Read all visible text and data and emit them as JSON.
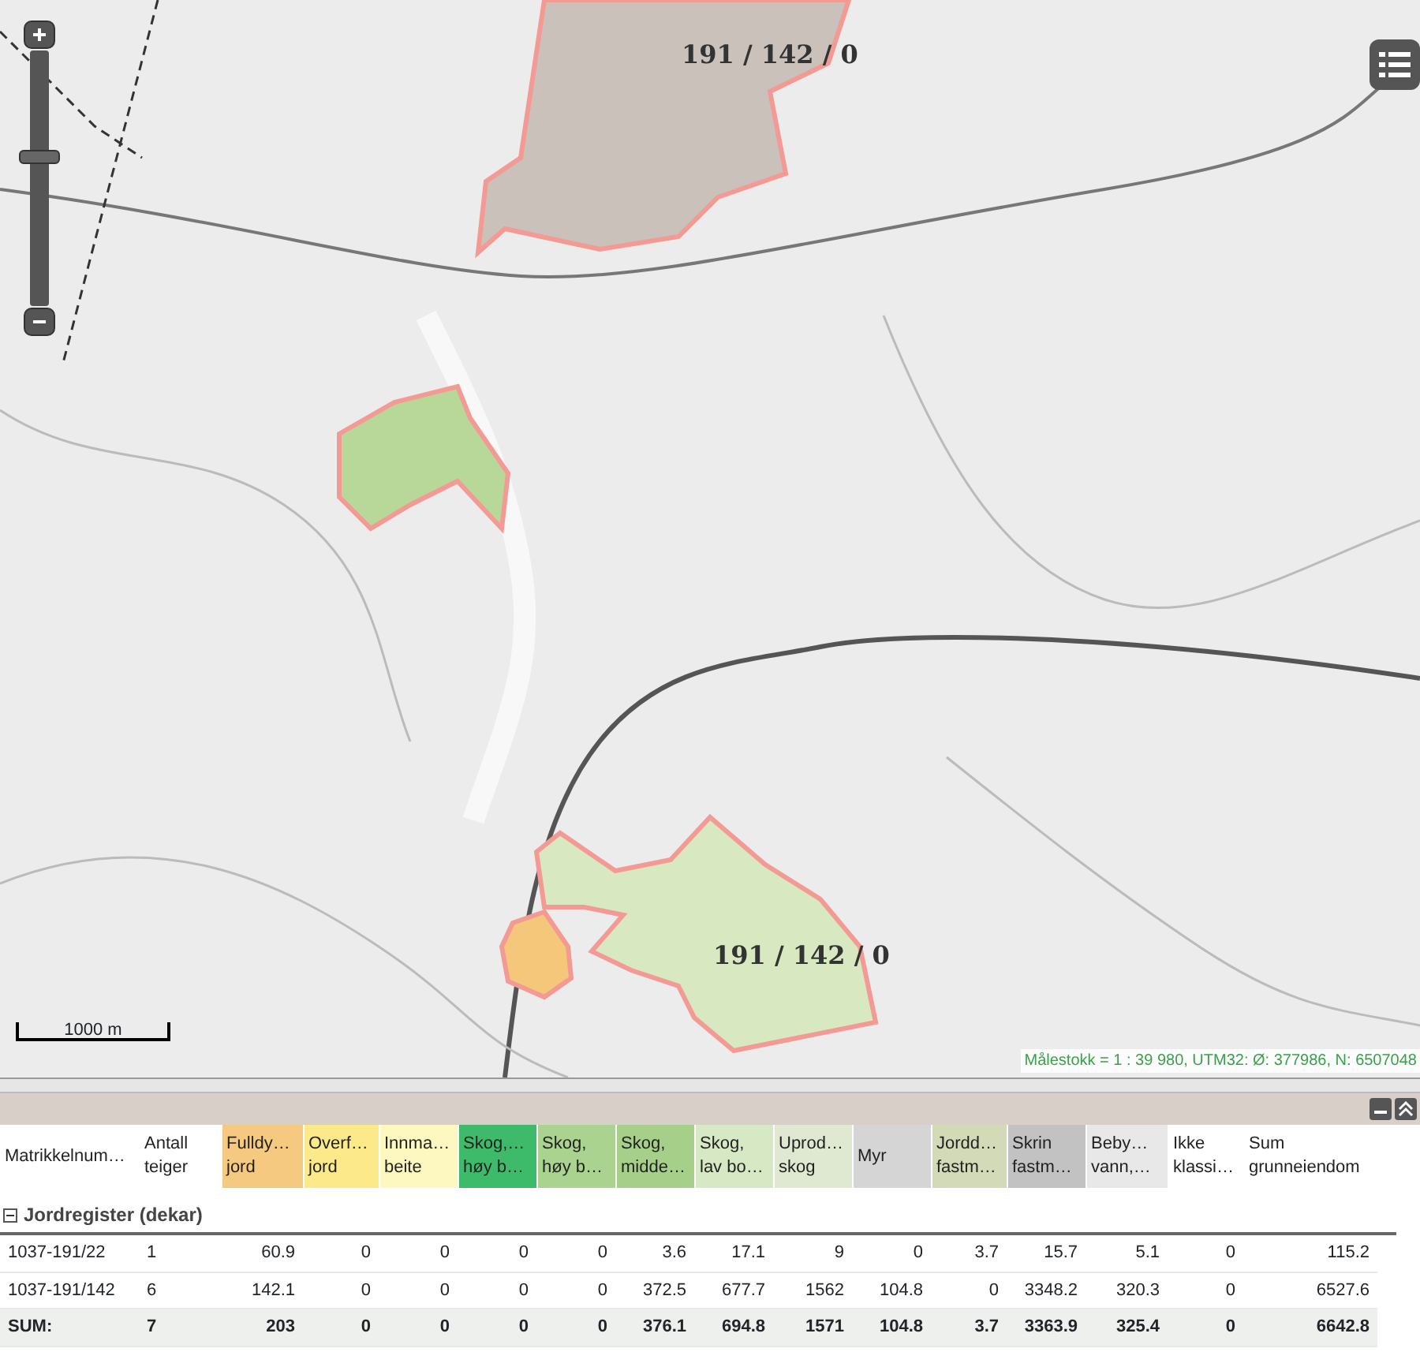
{
  "map": {
    "zoom_slider": {
      "level": 0.6
    },
    "parcels": [
      {
        "label": "191 / 142 / 0"
      },
      {
        "label": "191 / 142 / 0"
      }
    ],
    "scale_bar": "1000 m",
    "scale_text": "Målestokk = 1 : 39 980, UTM32: Ø: 377986, N: 6507048"
  },
  "panel": {
    "columns": [
      {
        "label": "Matrikkelnum…",
        "color": "#ffffff"
      },
      {
        "label": "Antall\nteiger",
        "color": "#ffffff"
      },
      {
        "label": "Fulldy…\njord",
        "color": "#f5c97f"
      },
      {
        "label": "Overf…\njord",
        "color": "#fbe98a"
      },
      {
        "label": "Innma…\nbeite",
        "color": "#fdf7c0"
      },
      {
        "label": "Skog,…\nhøy b…",
        "color": "#3dbb6a"
      },
      {
        "label": "Skog,\nhøy b…",
        "color": "#a9d38e"
      },
      {
        "label": "Skog,\nmidde…",
        "color": "#a6cf8a"
      },
      {
        "label": "Skog,\nlav bo…",
        "color": "#d6e8c4"
      },
      {
        "label": "Uprod…\nskog",
        "color": "#dfe9d1"
      },
      {
        "label": "Myr",
        "color": "#d5d5d5"
      },
      {
        "label": "Jordd…\nfastm…",
        "color": "#d3dab8"
      },
      {
        "label": "Skrin\nfastm…",
        "color": "#c2c2c2"
      },
      {
        "label": "Beby…\nvann,…",
        "color": "#e8e8e8"
      },
      {
        "label": "Ikke\nklassi…",
        "color": "#ffffff"
      },
      {
        "label": "Sum\ngrunneiendom",
        "color": "#ffffff"
      }
    ],
    "group": {
      "label": "Jordregister (dekar)",
      "expanded": true
    },
    "rows": [
      {
        "kind": "data",
        "cells": [
          "1037-191/22",
          "1",
          "60.9",
          "0",
          "0",
          "0",
          "0",
          "3.6",
          "17.1",
          "9",
          "0",
          "3.7",
          "15.7",
          "5.1",
          "0",
          "115.2"
        ]
      },
      {
        "kind": "data",
        "cells": [
          "1037-191/142",
          "6",
          "142.1",
          "0",
          "0",
          "0",
          "0",
          "372.5",
          "677.7",
          "1562",
          "104.8",
          "0",
          "3348.2",
          "320.3",
          "0",
          "6527.6"
        ]
      },
      {
        "kind": "sum",
        "cells": [
          "SUM:",
          "7",
          "203",
          "0",
          "0",
          "0",
          "0",
          "376.1",
          "694.8",
          "1571",
          "104.8",
          "3.7",
          "3363.9",
          "325.4",
          "0",
          "6642.8"
        ]
      }
    ]
  }
}
